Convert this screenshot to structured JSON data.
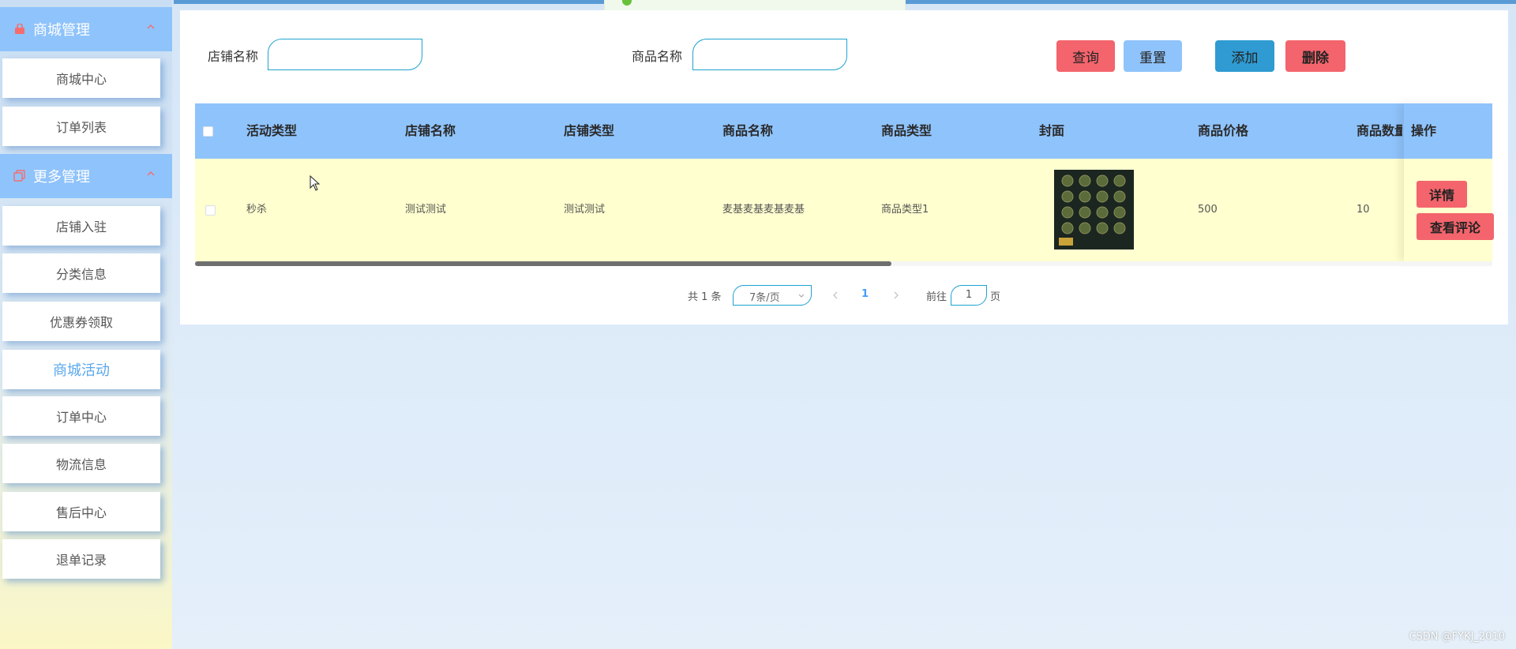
{
  "sidebar": {
    "groups": [
      {
        "label": "商城管理",
        "icon": "bag-icon",
        "items": [
          {
            "label": "商城中心"
          },
          {
            "label": "订单列表"
          }
        ]
      },
      {
        "label": "更多管理",
        "icon": "copy-icon",
        "items": [
          {
            "label": "店铺入驻"
          },
          {
            "label": "分类信息"
          },
          {
            "label": "优惠券领取"
          },
          {
            "label": "商城活动",
            "active": true
          },
          {
            "label": "订单中心"
          },
          {
            "label": "物流信息"
          },
          {
            "label": "售后中心"
          },
          {
            "label": "退单记录"
          }
        ]
      }
    ]
  },
  "search": {
    "shop_label": "店铺名称",
    "shop_value": "",
    "product_label": "商品名称",
    "product_value": ""
  },
  "actions": {
    "query": "查询",
    "reset": "重置",
    "add": "添加",
    "delete": "删除"
  },
  "colors": {
    "primary": "#8fc3fb",
    "danger": "#f3646c",
    "add": "#2f9bd2",
    "row": "#ffffcf"
  },
  "table": {
    "columns": [
      "活动类型",
      "店铺名称",
      "店铺类型",
      "商品名称",
      "商品类型",
      "封面",
      "商品价格",
      "商品数量",
      "操作"
    ],
    "rows": [
      {
        "activity_type": "秒杀",
        "shop_name": "测试测试",
        "shop_type": "测试测试",
        "product_name": "麦基麦基麦基麦基",
        "product_type": "商品类型1",
        "cover": "cover-image",
        "price": "500",
        "quantity": "10"
      }
    ],
    "row_actions": {
      "detail": "详情",
      "comments": "查看评论"
    }
  },
  "pagination": {
    "total": "共 1 条",
    "page_size": "7条/页",
    "current": "1",
    "goto_prefix": "前往",
    "goto_value": "1",
    "goto_suffix": "页"
  },
  "watermark": "CSDN @FYKJ_2010"
}
